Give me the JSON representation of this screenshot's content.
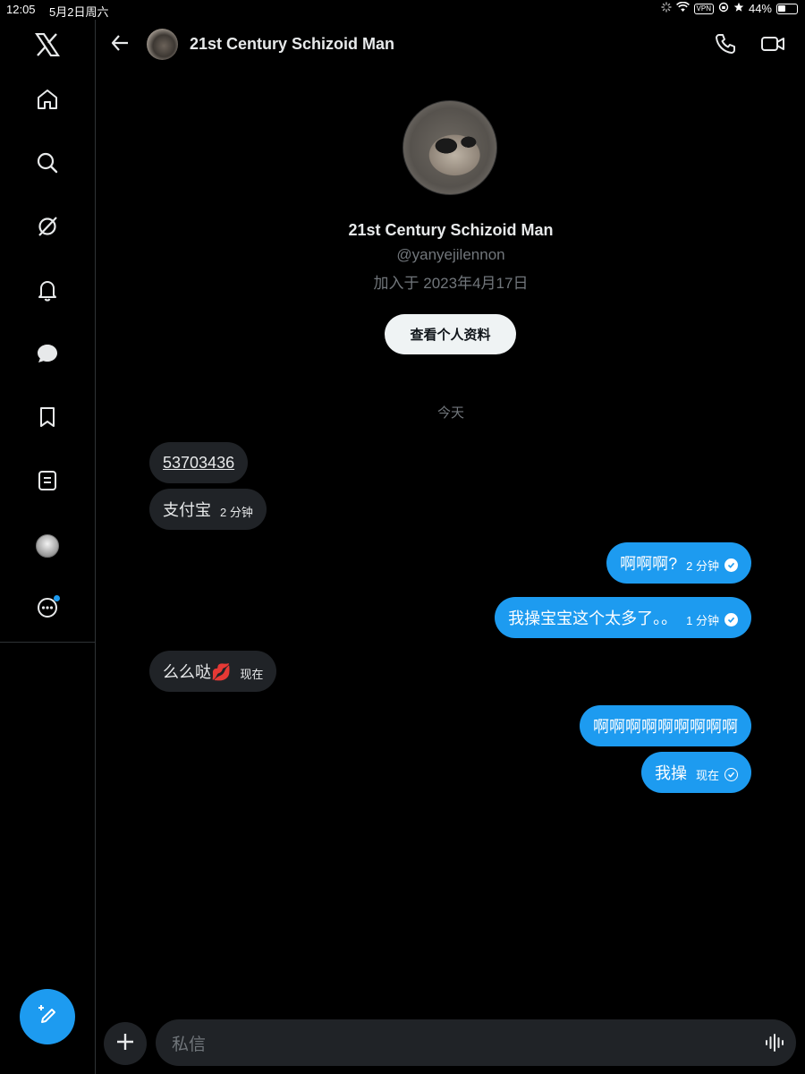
{
  "status_bar": {
    "time": "12:05",
    "date": "5月2日周六",
    "vpn": "VPN",
    "battery": "44%"
  },
  "sidebar": {
    "items": [
      {
        "icon": "x-logo-icon"
      },
      {
        "icon": "home-icon"
      },
      {
        "icon": "search-icon"
      },
      {
        "icon": "grok-icon"
      },
      {
        "icon": "bell-icon"
      },
      {
        "icon": "messages-icon"
      },
      {
        "icon": "bookmark-icon"
      },
      {
        "icon": "lists-icon"
      },
      {
        "icon": "profile-avatar"
      },
      {
        "icon": "more-icon"
      }
    ],
    "compose_icon": "compose-icon"
  },
  "header": {
    "title": "21st Century Schizoid Man"
  },
  "profile": {
    "name": "21st Century Schizoid Man",
    "handle": "@yanyejilennon",
    "joined": "加入于 2023年4月17日",
    "view_profile_label": "查看个人资料"
  },
  "conversation": {
    "date_divider": "今天",
    "messages": [
      {
        "direction": "in",
        "text": "53703436",
        "time": ""
      },
      {
        "direction": "in",
        "text": "支付宝",
        "time": "2 分钟"
      },
      {
        "direction": "out",
        "text": "啊啊啊?",
        "time": "2 分钟",
        "status": "read"
      },
      {
        "direction": "out",
        "text": "我操宝宝这个太多了。。",
        "time": "1 分钟",
        "status": "read"
      },
      {
        "direction": "in",
        "text": "么么哒💋",
        "time": "现在"
      },
      {
        "direction": "out",
        "text": "啊啊啊啊啊啊啊啊啊",
        "time": ""
      },
      {
        "direction": "out",
        "text": "我操",
        "time": "现在",
        "status": "sent"
      }
    ]
  },
  "composer": {
    "placeholder": "私信"
  },
  "colors": {
    "accent": "#1d9bf0",
    "background": "#000000",
    "bubble_incoming": "#202327",
    "muted_text": "#71767b"
  }
}
